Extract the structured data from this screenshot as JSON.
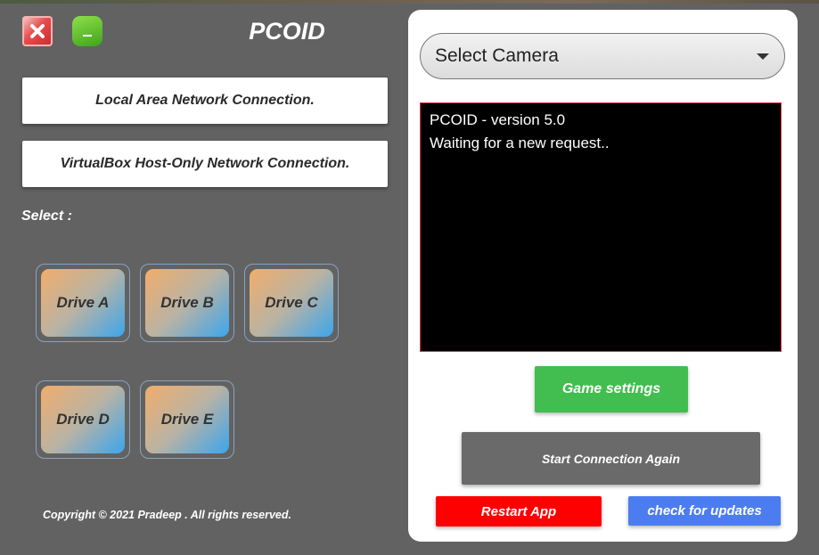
{
  "window": {
    "title": "PCOID",
    "close_icon": "close-icon",
    "minimize_icon": "minimize-icon"
  },
  "network": {
    "options": [
      "Local Area Network Connection.",
      "VirtualBox Host-Only Network Connection."
    ]
  },
  "drives": {
    "label": "Select :",
    "items": [
      "Drive A",
      "Drive B",
      "Drive C",
      "Drive D",
      "Drive E"
    ]
  },
  "footer": {
    "copyright": "Copyright © 2021  Pradeep . All rights reserved."
  },
  "camera": {
    "selected": "Select Camera"
  },
  "console": {
    "lines": [
      "PCOID - version 5.0",
      "Waiting for a new request.."
    ]
  },
  "actions": {
    "game_settings": "Game settings",
    "start_connection": "Start Connection Again",
    "restart_app": "Restart App",
    "check_updates": "check for updates"
  },
  "colors": {
    "game_settings": "#42bd4f",
    "restart_app": "#ff0000",
    "check_updates": "#4c7df0",
    "console_border": "#e0303a"
  }
}
